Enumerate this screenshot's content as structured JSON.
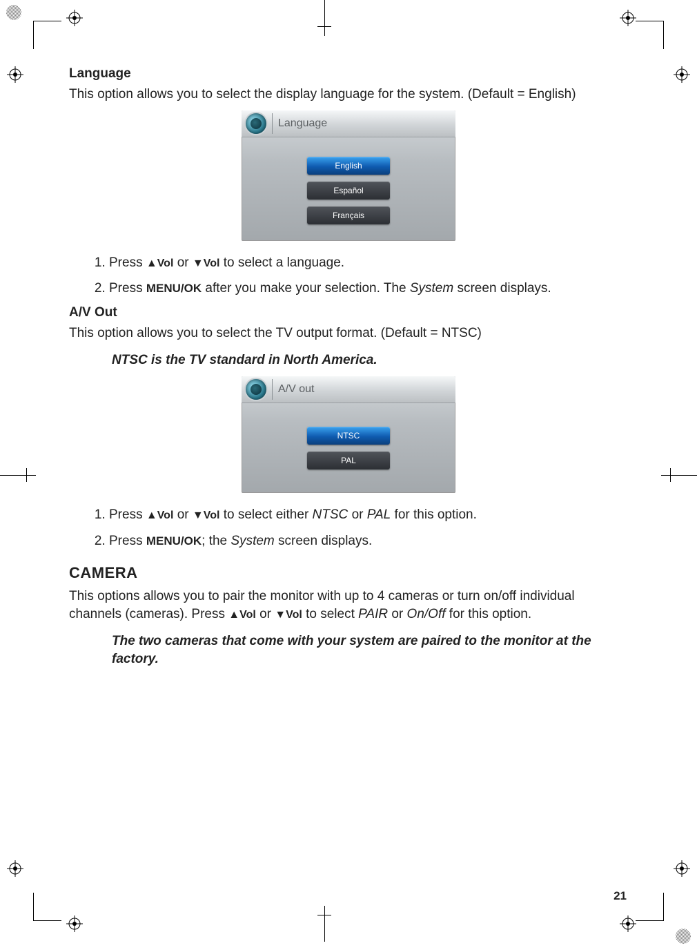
{
  "page_number": "21",
  "sections": {
    "language": {
      "heading": "Language",
      "intro": "This option allows you to select the display language for the system. (Default = English)",
      "osd_title": "Language",
      "options": [
        "English",
        "Español",
        "Français"
      ],
      "steps_prefix": [
        "Press ",
        "Press "
      ],
      "step1_tail": " to select a language.",
      "step2_btn": "MENU/OK",
      "step2_mid": " after you make your selection. The ",
      "step2_italic": "System",
      "step2_tail": " screen displays."
    },
    "avout": {
      "heading": "A/V Out",
      "intro": "This option allows you to select the TV output format. (Default = NTSC)",
      "note": "NTSC is the TV standard in North America.",
      "osd_title": "A/V out",
      "options": [
        "NTSC",
        "PAL"
      ],
      "step1_mid": " to select either ",
      "step1_i1": "NTSC",
      "step1_or": " or ",
      "step1_i2": "PAL",
      "step1_tail": " for this option.",
      "step2_btn": "MENU/OK",
      "step2_mid": "; the ",
      "step2_italic": "System",
      "step2_tail": " screen displays."
    },
    "camera": {
      "heading": "CAMERA",
      "intro_a": "This options allows you to pair the monitor with up to 4 cameras or turn on/off individual channels (cameras). Press ",
      "intro_mid": " to select ",
      "intro_i1": "PAIR",
      "intro_or": " or ",
      "intro_i2": "On/Off",
      "intro_tail": " for this option.",
      "note": "The two cameras that come with your system are paired to the monitor at the factory."
    }
  },
  "keys": {
    "vol_up": "▲Vol",
    "vol_dn": "▼Vol",
    "or": " or "
  }
}
